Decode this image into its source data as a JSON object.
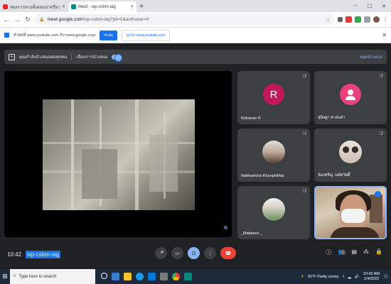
{
  "browser": {
    "tabs": [
      {
        "title": "ช่องการทางทั้งสอบน่าหรือ | ผังมน",
        "color": "#d93025",
        "active": false
      },
      {
        "title": "Meet - ixp-csbm-iag",
        "color": "#00897b",
        "active": true
      }
    ],
    "new_tab": "+",
    "url_host": "meet.google.com",
    "url_path": "/ixp-csbm-iag?pli=1&authuser=0"
  },
  "infobar": {
    "message": "ทำต่อที่ www.youtube.com กับ meet.google.com",
    "primary": "ทำต่อ",
    "secondary": "ทุกกับ www.youtube.com"
  },
  "notice": {
    "text": "คุณกำลังนำเสนอต่อทุกคน",
    "action": "เลือกการนำเสนอ",
    "right": "หยุดนำเสนอ"
  },
  "participants": [
    {
      "name": "Rohanee R",
      "initial": "R",
      "color": "#c2185b"
    },
    {
      "name": "สุนิษฐา ตาลนสา",
      "initial": "",
      "color": "#ec407a"
    },
    {
      "name": "Natthanicha Khunphithat",
      "initial": "",
      "color": "#d5d5d5"
    },
    {
      "name": "น้องชริญ วงค์สวัสดิ์",
      "initial": "",
      "color": "#d5d5d5"
    },
    {
      "name": "_Matawee _",
      "initial": "",
      "color": "#c9c9c9"
    }
  ],
  "meeting": {
    "time": "10:42",
    "code": "ixp-csbm-iag",
    "participant_count": "7"
  },
  "taskbar": {
    "search_placeholder": "Type here to search",
    "weather": "82°F  Partly sunny",
    "clock_time": "10:42 AM",
    "clock_date": "1/4/2022"
  }
}
